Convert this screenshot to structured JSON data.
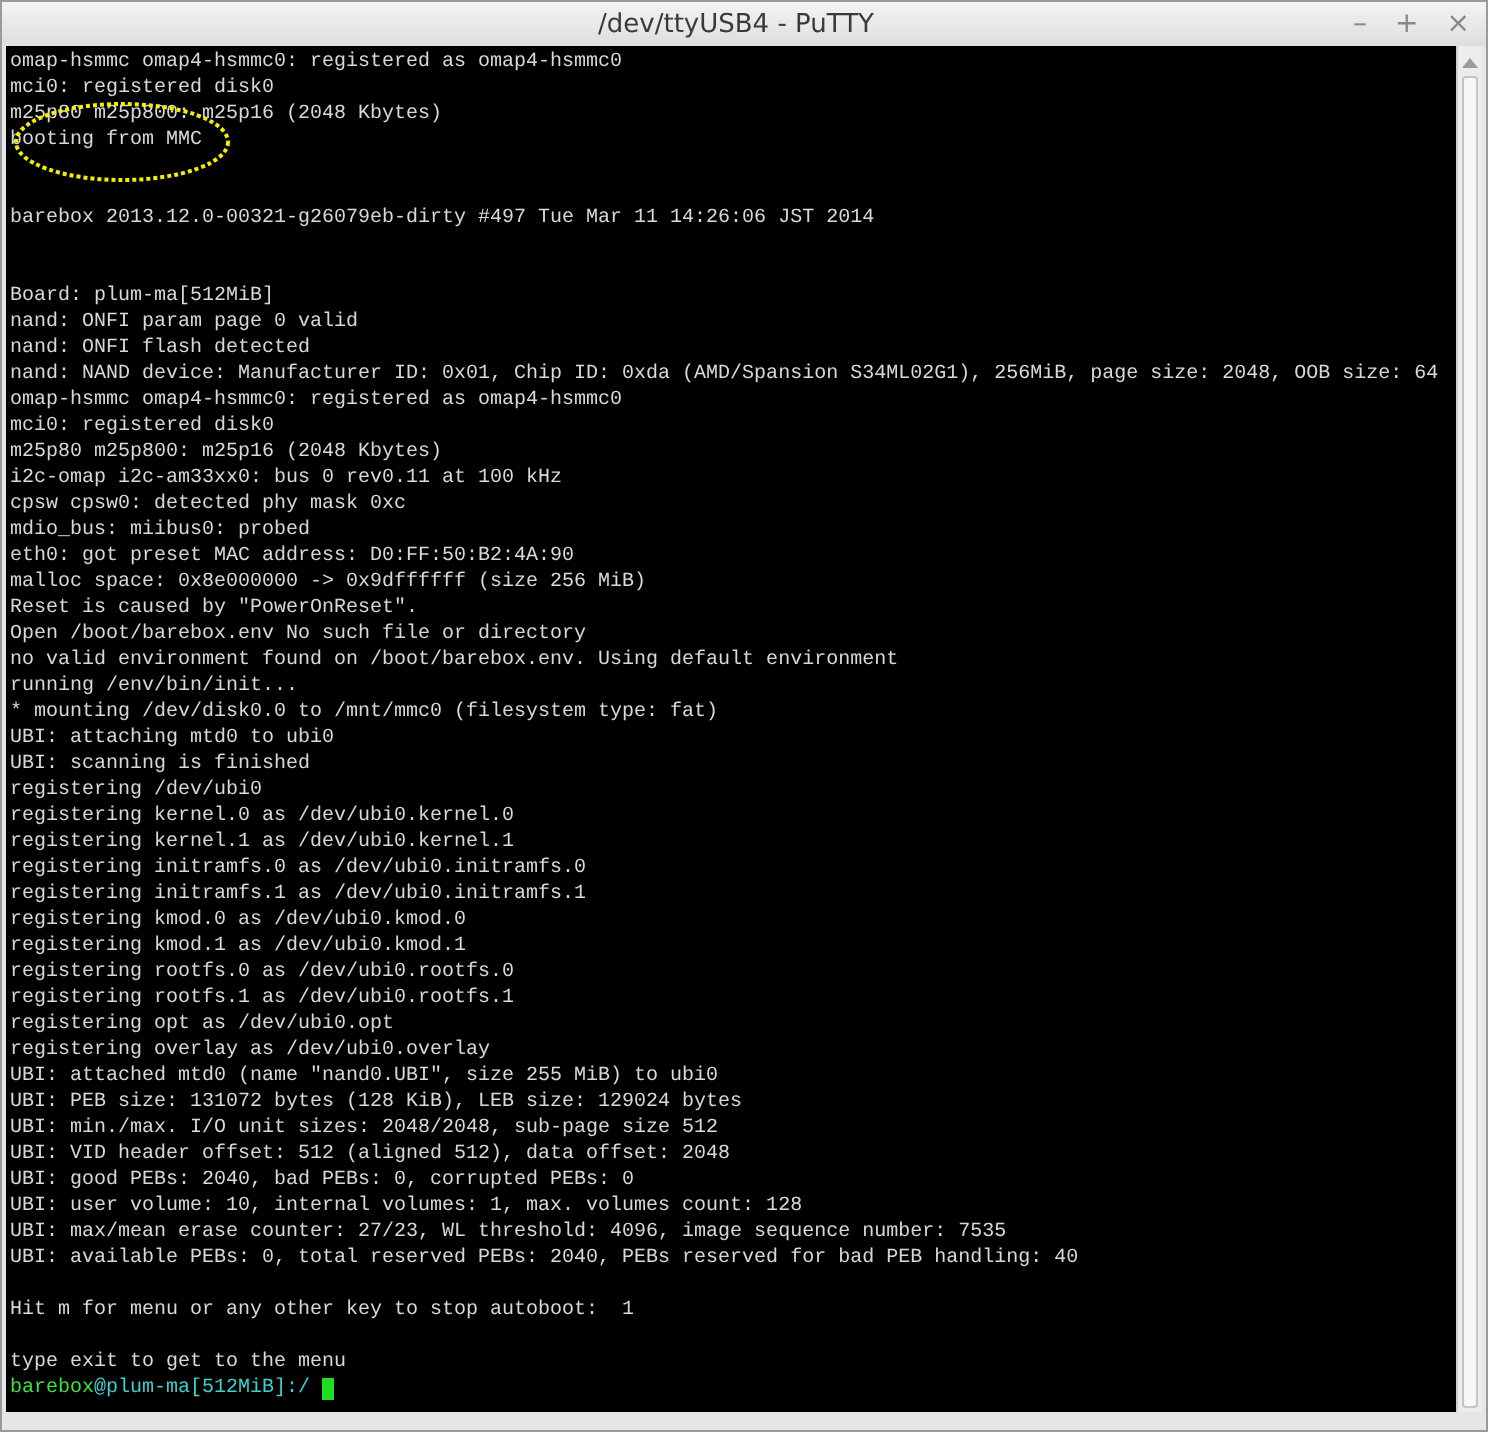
{
  "window": {
    "title": "/dev/ttyUSB4 - PuTTY",
    "controls": [
      "–",
      "+",
      "×"
    ]
  },
  "terminal": {
    "lines": [
      {
        "kind": "text",
        "text": "omap-hsmmc omap4-hsmmc0: registered as omap4-hsmmc0",
        "circled": false
      },
      {
        "kind": "text",
        "text": "mci0: registered disk0",
        "circled": false
      },
      {
        "kind": "text",
        "text": "m25p80 m25p800: m25p16 (2048 Kbytes)",
        "circled": false
      },
      {
        "kind": "text",
        "text": "booting from MMC",
        "circled": true
      },
      {
        "kind": "blank"
      },
      {
        "kind": "blank"
      },
      {
        "kind": "text",
        "text": "barebox 2013.12.0-00321-g26079eb-dirty #497 Tue Mar 11 14:26:06 JST 2014",
        "circled": false
      },
      {
        "kind": "blank"
      },
      {
        "kind": "blank"
      },
      {
        "kind": "text",
        "text": "Board: plum-ma[512MiB]",
        "circled": false
      },
      {
        "kind": "text",
        "text": "nand: ONFI param page 0 valid",
        "circled": false
      },
      {
        "kind": "text",
        "text": "nand: ONFI flash detected",
        "circled": false
      },
      {
        "kind": "text",
        "text": "nand: NAND device: Manufacturer ID: 0x01, Chip ID: 0xda (AMD/Spansion S34ML02G1), 256MiB, page size: 2048, OOB size: 64",
        "circled": false
      },
      {
        "kind": "text",
        "text": "omap-hsmmc omap4-hsmmc0: registered as omap4-hsmmc0",
        "circled": false
      },
      {
        "kind": "text",
        "text": "mci0: registered disk0",
        "circled": false
      },
      {
        "kind": "text",
        "text": "m25p80 m25p800: m25p16 (2048 Kbytes)",
        "circled": false
      },
      {
        "kind": "text",
        "text": "i2c-omap i2c-am33xx0: bus 0 rev0.11 at 100 kHz",
        "circled": false
      },
      {
        "kind": "text",
        "text": "cpsw cpsw0: detected phy mask 0xc",
        "circled": false
      },
      {
        "kind": "text",
        "text": "mdio_bus: miibus0: probed",
        "circled": false
      },
      {
        "kind": "text",
        "text": "eth0: got preset MAC address: D0:FF:50:B2:4A:90",
        "circled": false
      },
      {
        "kind": "text",
        "text": "malloc space: 0x8e000000 -> 0x9dffffff (size 256 MiB)",
        "circled": false
      },
      {
        "kind": "text",
        "text": "Reset is caused by \"PowerOnReset\".",
        "circled": false
      },
      {
        "kind": "text",
        "text": "Open /boot/barebox.env No such file or directory",
        "circled": false
      },
      {
        "kind": "text",
        "text": "no valid environment found on /boot/barebox.env. Using default environment",
        "circled": false
      },
      {
        "kind": "text",
        "text": "running /env/bin/init...",
        "circled": false
      },
      {
        "kind": "text",
        "text": "* mounting /dev/disk0.0 to /mnt/mmc0 (filesystem type: fat)",
        "circled": false
      },
      {
        "kind": "text",
        "text": "UBI: attaching mtd0 to ubi0",
        "circled": false
      },
      {
        "kind": "text",
        "text": "UBI: scanning is finished",
        "circled": false
      },
      {
        "kind": "text",
        "text": "registering /dev/ubi0",
        "circled": false
      },
      {
        "kind": "text",
        "text": "registering kernel.0 as /dev/ubi0.kernel.0",
        "circled": false
      },
      {
        "kind": "text",
        "text": "registering kernel.1 as /dev/ubi0.kernel.1",
        "circled": false
      },
      {
        "kind": "text",
        "text": "registering initramfs.0 as /dev/ubi0.initramfs.0",
        "circled": false
      },
      {
        "kind": "text",
        "text": "registering initramfs.1 as /dev/ubi0.initramfs.1",
        "circled": false
      },
      {
        "kind": "text",
        "text": "registering kmod.0 as /dev/ubi0.kmod.0",
        "circled": false
      },
      {
        "kind": "text",
        "text": "registering kmod.1 as /dev/ubi0.kmod.1",
        "circled": false
      },
      {
        "kind": "text",
        "text": "registering rootfs.0 as /dev/ubi0.rootfs.0",
        "circled": false
      },
      {
        "kind": "text",
        "text": "registering rootfs.1 as /dev/ubi0.rootfs.1",
        "circled": false
      },
      {
        "kind": "text",
        "text": "registering opt as /dev/ubi0.opt",
        "circled": false
      },
      {
        "kind": "text",
        "text": "registering overlay as /dev/ubi0.overlay",
        "circled": false
      },
      {
        "kind": "text",
        "text": "UBI: attached mtd0 (name \"nand0.UBI\", size 255 MiB) to ubi0",
        "circled": false
      },
      {
        "kind": "text",
        "text": "UBI: PEB size: 131072 bytes (128 KiB), LEB size: 129024 bytes",
        "circled": false
      },
      {
        "kind": "text",
        "text": "UBI: min./max. I/O unit sizes: 2048/2048, sub-page size 512",
        "circled": false
      },
      {
        "kind": "text",
        "text": "UBI: VID header offset: 512 (aligned 512), data offset: 2048",
        "circled": false
      },
      {
        "kind": "text",
        "text": "UBI: good PEBs: 2040, bad PEBs: 0, corrupted PEBs: 0",
        "circled": false
      },
      {
        "kind": "text",
        "text": "UBI: user volume: 10, internal volumes: 1, max. volumes count: 128",
        "circled": false
      },
      {
        "kind": "text",
        "text": "UBI: max/mean erase counter: 27/23, WL threshold: 4096, image sequence number: 7535",
        "circled": false
      },
      {
        "kind": "text",
        "text": "UBI: available PEBs: 0, total reserved PEBs: 2040, PEBs reserved for bad PEB handling: 40",
        "circled": false
      },
      {
        "kind": "blank"
      },
      {
        "kind": "text",
        "text": "Hit m for menu or any other key to stop autoboot:  1",
        "circled": false
      },
      {
        "kind": "blank"
      },
      {
        "kind": "text",
        "text": "type exit to get to the menu",
        "circled": false
      }
    ],
    "prompt": {
      "parts": [
        {
          "text": "barebox",
          "color": "#3ee23e"
        },
        {
          "text": "@plum-ma[512MiB]:/",
          "color": "#3ecfcf"
        }
      ],
      "cursor": true
    }
  }
}
